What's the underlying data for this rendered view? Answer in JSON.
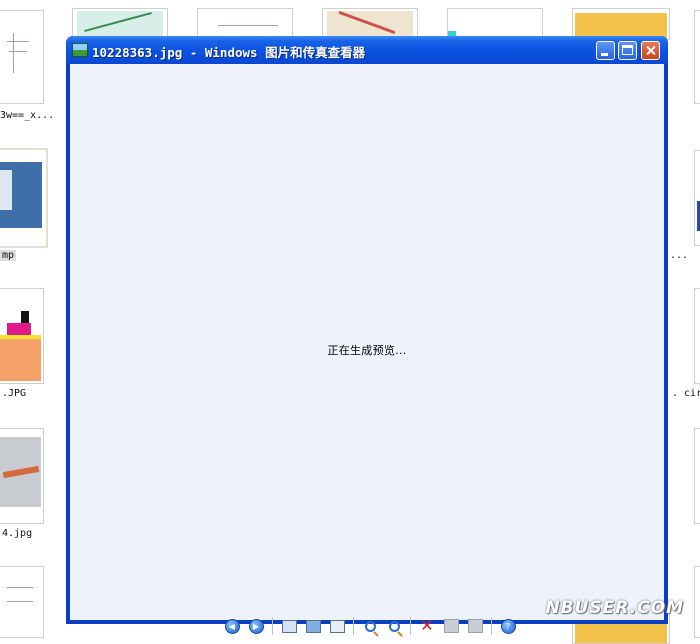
{
  "window": {
    "title": "10228363.jpg - Windows 图片和传真查看器",
    "status_text": "正在生成预览..."
  },
  "desktop": {
    "captions": [
      "3w==_x...",
      "mp",
      ".JPG",
      "4.jpg",
      "...",
      ". cir"
    ]
  },
  "toolbar": {
    "buttons": [
      "previous-image",
      "next-image",
      "best-fit",
      "actual-size",
      "slideshow",
      "zoom-in",
      "zoom-out",
      "delete",
      "print",
      "copy-to",
      "help"
    ]
  },
  "colors": {
    "titlebar": "#0b52e0",
    "client_bg": "#eef3fb",
    "close_button": "#c9451c"
  },
  "watermark": "NBUSER.COM"
}
